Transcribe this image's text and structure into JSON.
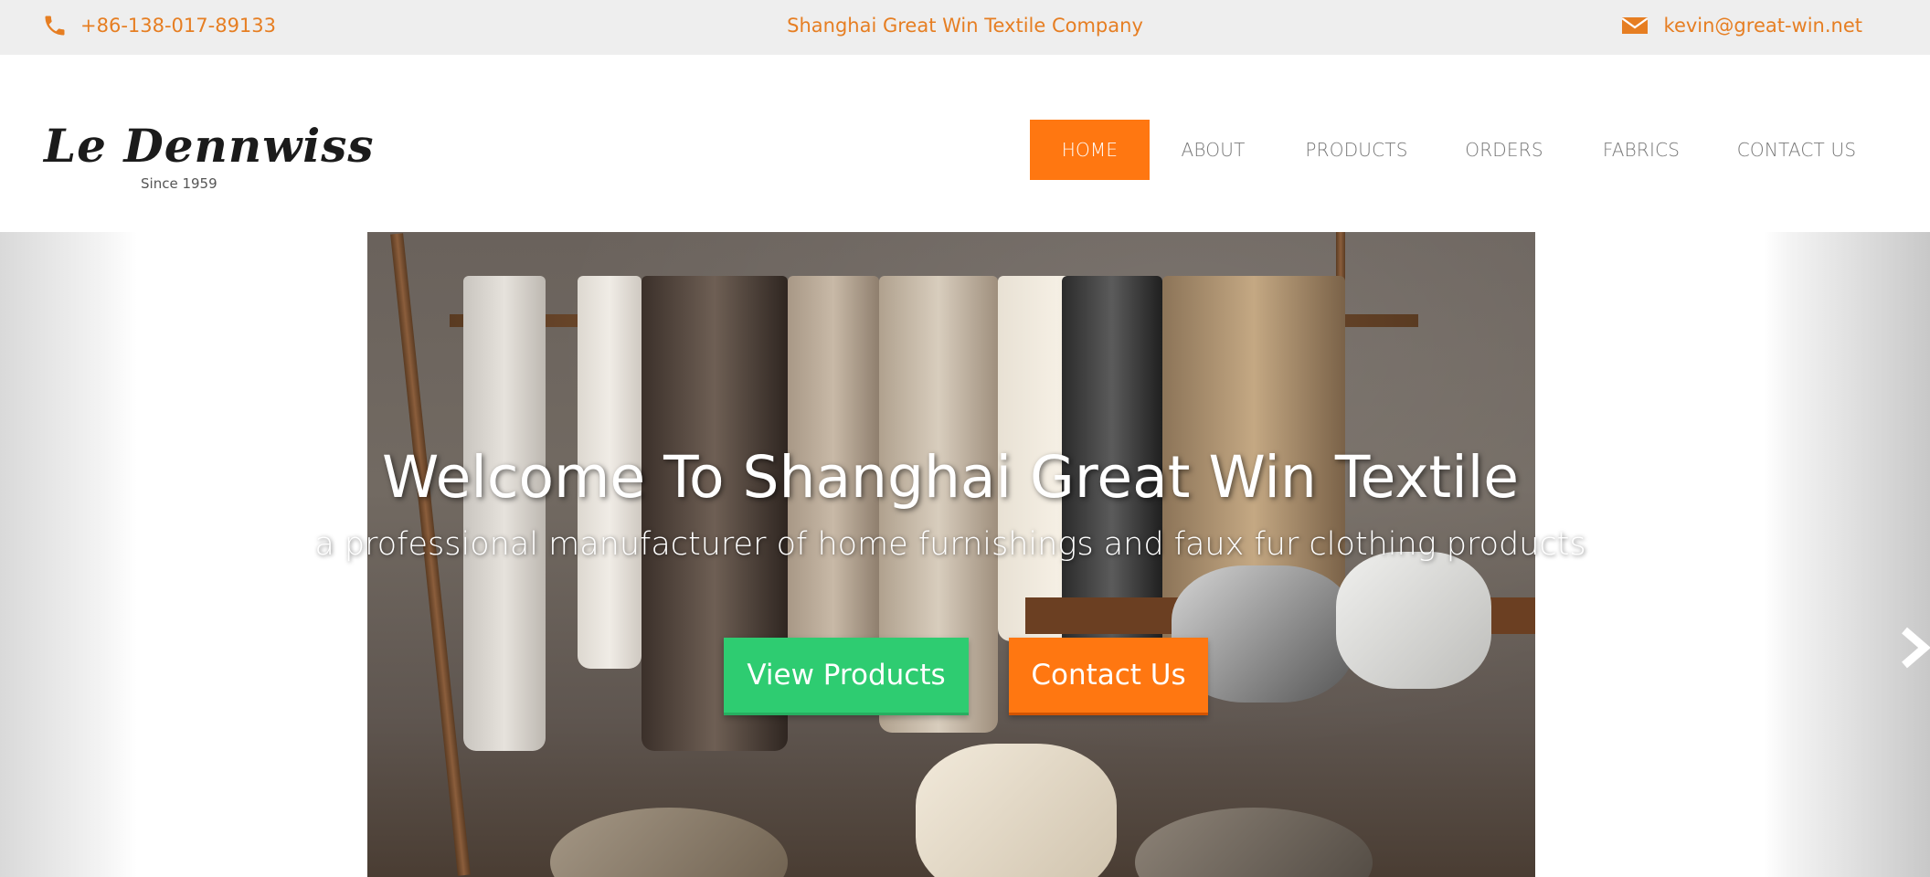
{
  "topbar": {
    "phone": "+86-138-017-89133",
    "company": "Shanghai Great Win Textile Company",
    "email": "kevin@great-win.net",
    "accent_color": "#e67e22"
  },
  "logo": {
    "script": "Le Dennwiss",
    "since": "Since 1959"
  },
  "nav": {
    "items": [
      {
        "label": "HOME",
        "active": true
      },
      {
        "label": "ABOUT"
      },
      {
        "label": "PRODUCTS"
      },
      {
        "label": "ORDERS"
      },
      {
        "label": "FABRICS"
      },
      {
        "label": "CONTACT US"
      }
    ],
    "active_color": "#ff7711"
  },
  "hero": {
    "title": "Welcome To Shanghai Great Win Textile",
    "subtitle": "a professional manufacturer of home furnishings and faux fur clothing products",
    "buttons": {
      "view": "View Products",
      "contact": "Contact Us"
    },
    "colors": {
      "view": "#2ecc71",
      "contact": "#ff7711"
    },
    "next_icon": "chevron-right-icon"
  }
}
